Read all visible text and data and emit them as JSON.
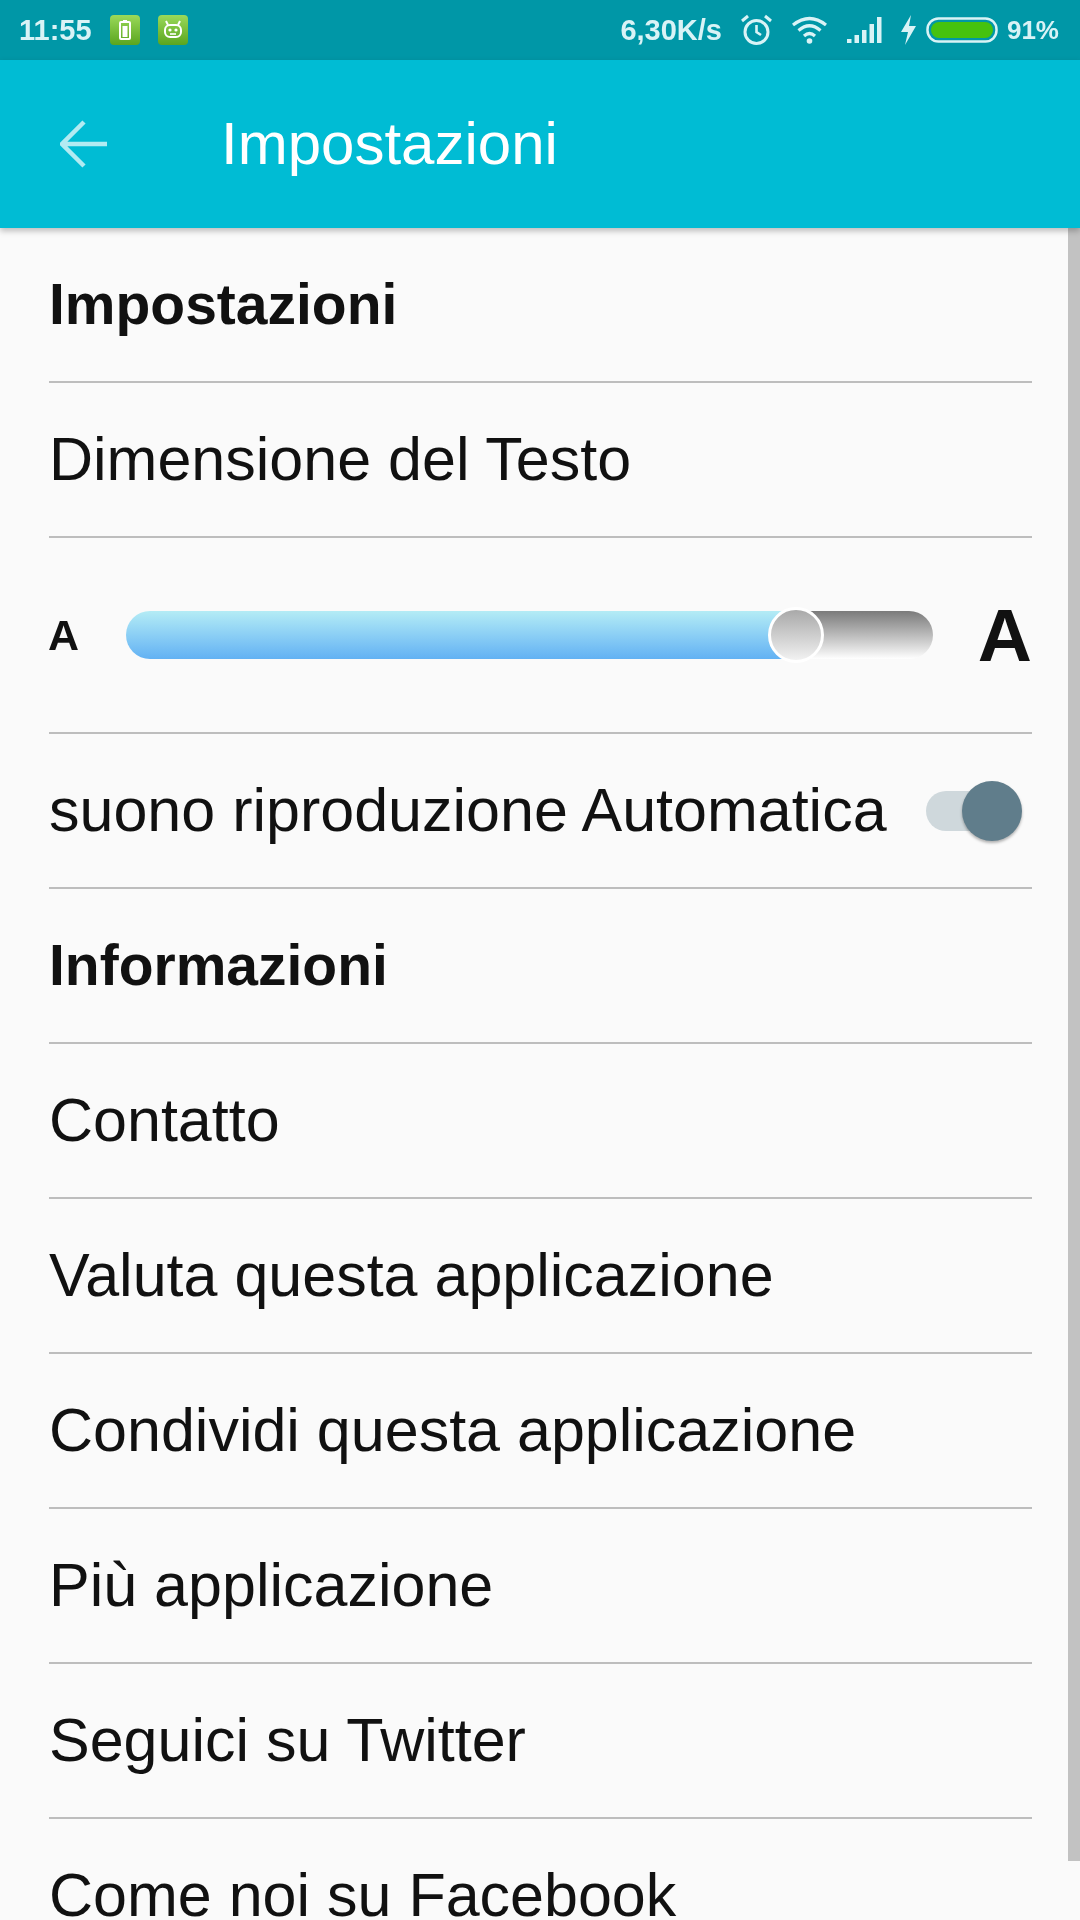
{
  "status_bar": {
    "time": "11:55",
    "network_speed": "6,30K/s",
    "battery_percent": "91%"
  },
  "app_bar": {
    "title": "Impostazioni"
  },
  "settings": [
    {
      "kind": "header",
      "label": "Impostazioni"
    },
    {
      "kind": "item",
      "label": "Dimensione del Testo"
    },
    {
      "kind": "slider",
      "small_label": "A",
      "large_label": "A",
      "level": 0.83
    },
    {
      "kind": "toggle",
      "label": "suono riproduzione Automatica",
      "on": true
    },
    {
      "kind": "header",
      "label": "Informazioni"
    },
    {
      "kind": "item",
      "label": "Contatto"
    },
    {
      "kind": "item",
      "label": "Valuta questa applicazione"
    },
    {
      "kind": "item",
      "label": "Condividi questa applicazione"
    },
    {
      "kind": "item",
      "label": "Più applicazione"
    },
    {
      "kind": "item",
      "label": "Seguici su Twitter"
    },
    {
      "kind": "item",
      "label": "Come noi su Facebook"
    }
  ]
}
